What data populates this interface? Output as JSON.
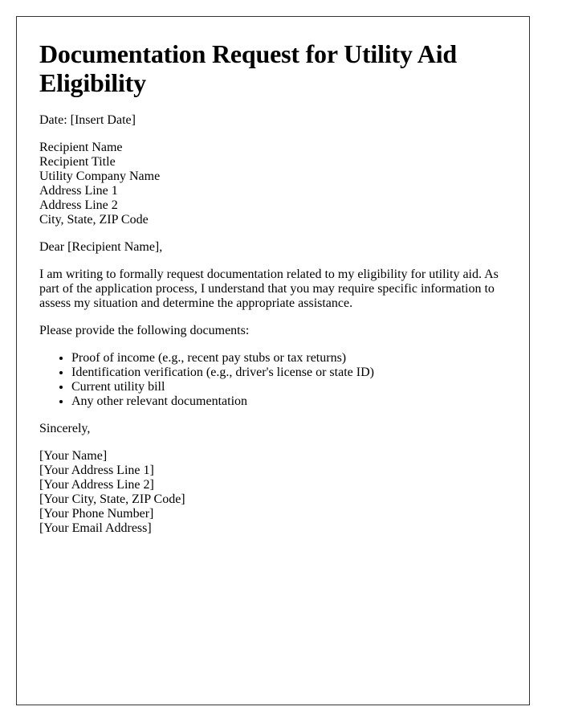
{
  "title": "Documentation Request for Utility Aid Eligibility",
  "date_line": "Date: [Insert Date]",
  "recipient": {
    "lines": [
      "Recipient Name",
      "Recipient Title",
      "Utility Company Name",
      "Address Line 1",
      "Address Line 2",
      "City, State, ZIP Code"
    ]
  },
  "salutation": "Dear [Recipient Name],",
  "body_paragraph": "I am writing to formally request documentation related to my eligibility for utility aid. As part of the application process, I understand that you may require specific information to assess my situation and determine the appropriate assistance.",
  "list_intro": "Please provide the following documents:",
  "documents": [
    "Proof of income (e.g., recent pay stubs or tax returns)",
    "Identification verification (e.g., driver's license or state ID)",
    "Current utility bill",
    "Any other relevant documentation"
  ],
  "closing": "Sincerely,",
  "sender": {
    "lines": [
      "[Your Name]",
      "[Your Address Line 1]",
      "[Your Address Line 2]",
      "[Your City, State, ZIP Code]",
      "[Your Phone Number]",
      "[Your Email Address]"
    ]
  }
}
